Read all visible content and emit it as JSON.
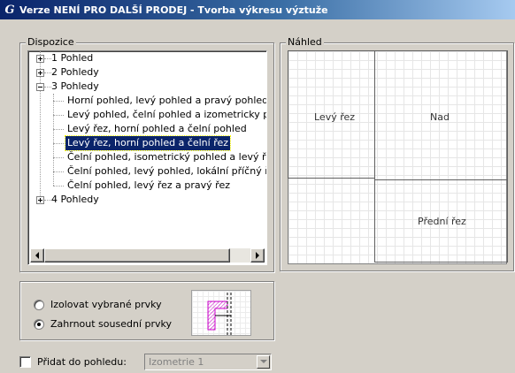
{
  "window": {
    "title": "Verze NENÍ PRO DALŠÍ PRODEJ - Tvorba výkresu výztuže",
    "icon": "app-logo-icon"
  },
  "dispozice": {
    "label": "Dispozice",
    "tree": [
      {
        "label": "1 Pohled",
        "expanded": false
      },
      {
        "label": "2 Pohledy",
        "expanded": false
      },
      {
        "label": "3 Pohledy",
        "expanded": true
      },
      {
        "label": "Horní pohled, levý pohled a pravý pohled"
      },
      {
        "label": "Levý pohled, čelní pohled a izometricky pohled"
      },
      {
        "label": "Levý řez, horní pohled a čelní pohled"
      },
      {
        "label": "Levý řez, horní pohled a čelní řez",
        "selected": true
      },
      {
        "label": "Čelní pohled, isometrický pohled a levý řez"
      },
      {
        "label": "Čelní pohled, levý pohled, lokální příčný řez"
      },
      {
        "label": "Čelní pohled, levý řez a pravý řez"
      },
      {
        "label": "4 Pohledy",
        "expanded": false
      }
    ]
  },
  "nahled": {
    "label": "Náhled",
    "views": {
      "left_section": "Levý řez",
      "top": "Nad",
      "front_section": "Přední řez"
    }
  },
  "options": {
    "isolate_label": "Izolovat vybrané prvky",
    "include_label": "Zahrnout sousední prvky",
    "selected": "include"
  },
  "add_to_view": {
    "label": "Přidat do pohledu:",
    "checked": false,
    "combo_value": "Izometrie 1"
  },
  "colors": {
    "titlebar_start": "#0a246a",
    "selection": "#0a246a",
    "rebar_magenta": "#cc00cc"
  }
}
